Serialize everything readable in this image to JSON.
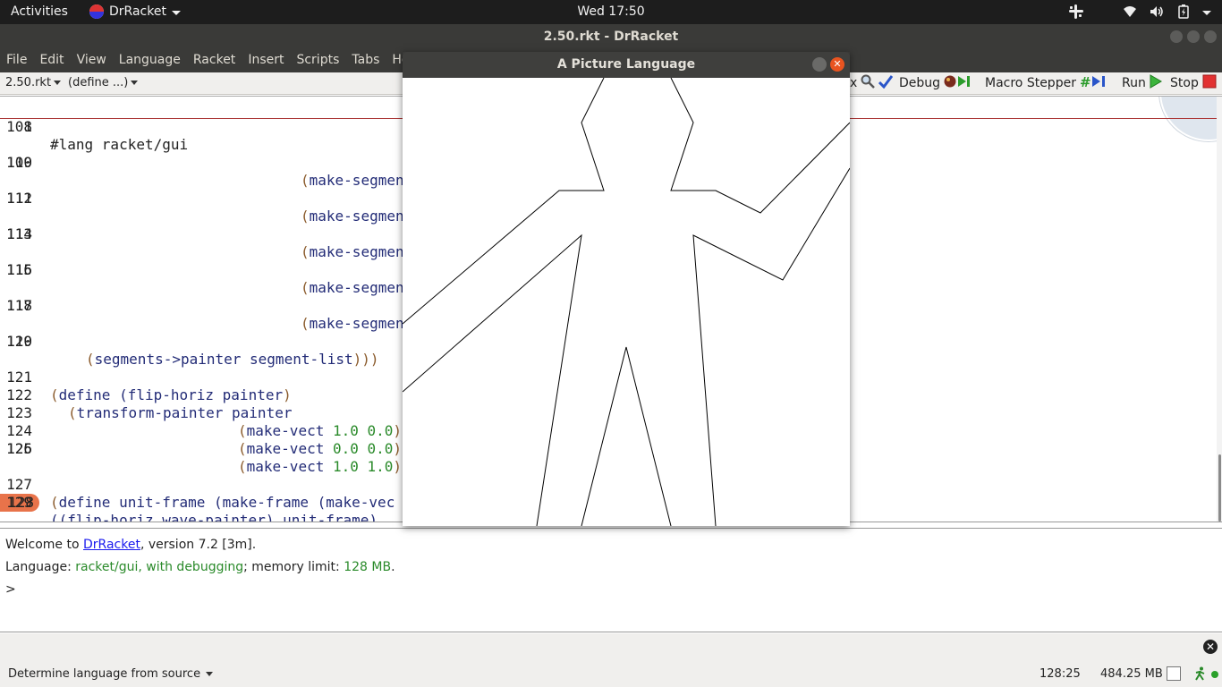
{
  "topbar": {
    "activities": "Activities",
    "app_name": "DrRacket",
    "clock": "Wed 17:50"
  },
  "window": {
    "title": "2.50.rkt - DrRacket"
  },
  "menubar": {
    "items": [
      "File",
      "Edit",
      "View",
      "Language",
      "Racket",
      "Insert",
      "Scripts",
      "Tabs",
      "Help"
    ]
  },
  "toolbar": {
    "file_dropdown": "2.50.rkt",
    "define_dropdown": "(define ...)",
    "check_syntax_fragment": "x",
    "debug": "Debug",
    "macro_stepper": "Macro Stepper",
    "run": "Run",
    "stop": "Stop"
  },
  "editor": {
    "first_line_number": "1",
    "first_line_code": "#lang racket/gui",
    "lines": [
      {
        "n": "108",
        "code": ""
      },
      {
        "n": "109",
        "code": "make-segmen"
      },
      {
        "n": "110",
        "code": ""
      },
      {
        "n": "111",
        "code": "make-segmen"
      },
      {
        "n": "112",
        "code": ""
      },
      {
        "n": "113",
        "code": "make-segmen"
      },
      {
        "n": "114",
        "code": ""
      },
      {
        "n": "115",
        "code": "make-segmen"
      },
      {
        "n": "116",
        "code": ""
      },
      {
        "n": "117",
        "code": "make-segmen"
      },
      {
        "n": "118",
        "code": ""
      },
      {
        "n": "119",
        "code": "segments->painter segment-list"
      },
      {
        "n": "120",
        "code": ""
      },
      {
        "n": "121",
        "code": "define (flip-horiz painter"
      },
      {
        "n": "122",
        "code": "transform-painter painter"
      },
      {
        "n": "123",
        "code": "make-vect 1.0 0.0"
      },
      {
        "n": "124",
        "code": "make-vect 0.0 0.0"
      },
      {
        "n": "125",
        "code": "make-vect 1.0 1.0"
      },
      {
        "n": "126",
        "code": ""
      },
      {
        "n": "127",
        "code": "define unit-frame (make-frame (make-vec"
      },
      {
        "n": "128",
        "code": "((flip-horiz wave-painter) unit-frame)"
      },
      {
        "n": "129",
        "code": ""
      }
    ]
  },
  "repl": {
    "welcome_prefix": "Welcome to ",
    "welcome_link": "DrRacket",
    "welcome_suffix": ", version 7.2 [3m].",
    "language_prefix": "Language: ",
    "language_value": "racket/gui, with debugging",
    "memory_prefix": "; memory limit: ",
    "memory_value": "128 MB",
    "memory_suffix": ".",
    "prompt": ">"
  },
  "statusbar": {
    "language_selector": "Determine language from source",
    "position": "128:25",
    "memory": "484.25 MB"
  },
  "picture_window": {
    "title": "A Picture Language"
  },
  "colors": {
    "topbar_bg": "#1d1d1d",
    "title_bg": "#3a3a38",
    "highlight_line": "#e8734a",
    "close_button": "#e95420",
    "keyword": "#232c77",
    "paren": "#8a5a2b",
    "number": "#2a8a2a"
  },
  "icons": [
    "racket-logo-icon",
    "network-icon",
    "volume-icon",
    "battery-icon",
    "slack-icon",
    "run-arrow-icon",
    "stop-square-icon",
    "debug-icon",
    "macro-stepper-icon",
    "check-mark-icon",
    "magnifier-icon"
  ]
}
